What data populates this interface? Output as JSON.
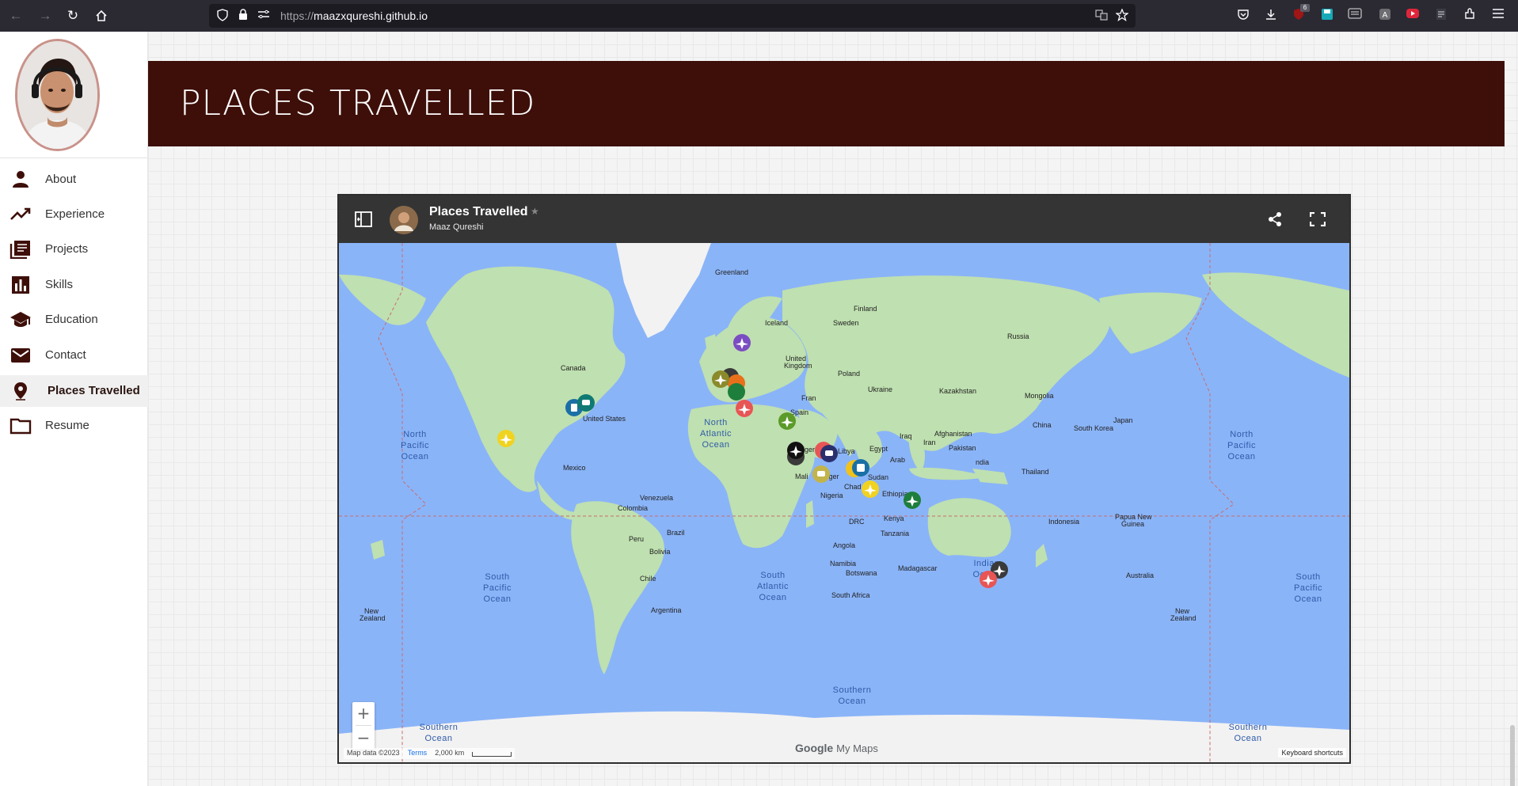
{
  "browser": {
    "url_scheme": "https://",
    "url_host": "maazxqureshi.github.io",
    "extension_badge": "6"
  },
  "sidebar": {
    "items": [
      {
        "label": "About",
        "icon": "person-icon"
      },
      {
        "label": "Experience",
        "icon": "trending-icon"
      },
      {
        "label": "Projects",
        "icon": "library-icon"
      },
      {
        "label": "Skills",
        "icon": "bar-chart-icon"
      },
      {
        "label": "Education",
        "icon": "school-icon"
      },
      {
        "label": "Contact",
        "icon": "mail-icon"
      },
      {
        "label": "Places Travelled",
        "icon": "location-pin-icon",
        "active": true
      },
      {
        "label": "Resume",
        "icon": "folder-icon"
      }
    ]
  },
  "banner": {
    "title": "PLACES TRAVELLED"
  },
  "map": {
    "title": "Places Travelled",
    "author": "Maaz Qureshi",
    "zoom_in": "+",
    "zoom_out": "−",
    "attribution": "Map data ©2023",
    "terms": "Terms",
    "scale": "2,000 km",
    "keyboard_shortcuts": "Keyboard shortcuts",
    "brand_google": "Google",
    "brand_mymaps": "My Maps",
    "oceans": [
      "North Pacific Ocean",
      "North Atlantic Ocean",
      "South Pacific Ocean",
      "South Atlantic Ocean",
      "Indian Ocean",
      "Southern Ocean"
    ],
    "places": [
      "Greenland",
      "Iceland",
      "Finland",
      "Sweden",
      "Russia",
      "Canada",
      "United Kingdom",
      "Poland",
      "Ukraine",
      "Kazakhstan",
      "Mongolia",
      "United States",
      "Spain",
      "France",
      "China",
      "South Korea",
      "Japan",
      "Iran",
      "Iraq",
      "Afghanistan",
      "Pakistan",
      "India",
      "Algeria",
      "Libya",
      "Egypt",
      "Mexico",
      "Mali",
      "Niger",
      "Chad",
      "Sudan",
      "Thailand",
      "Venezuela",
      "Colombia",
      "Nigeria",
      "Ethiopia",
      "Kenya",
      "DRC",
      "Tanzania",
      "Brazil",
      "Peru",
      "Indonesia",
      "Papua New Guinea",
      "Bolivia",
      "Angola",
      "Namibia",
      "Botswana",
      "Madagascar",
      "Australia",
      "Chile",
      "South Africa",
      "Argentina",
      "New Zealand",
      "Arabia"
    ]
  },
  "colors": {
    "banner": "#3e0f09",
    "ocean": "#8ab4f8",
    "land": "#bfe0b0",
    "marker_yellow": "#f0d321",
    "marker_red": "#e85555",
    "marker_purple": "#7b4dc2",
    "marker_green": "#1e7e3c",
    "marker_blue": "#1a6fa5",
    "marker_black": "#222222",
    "marker_olive": "#8a8a2a",
    "marker_orange": "#e8701a"
  }
}
